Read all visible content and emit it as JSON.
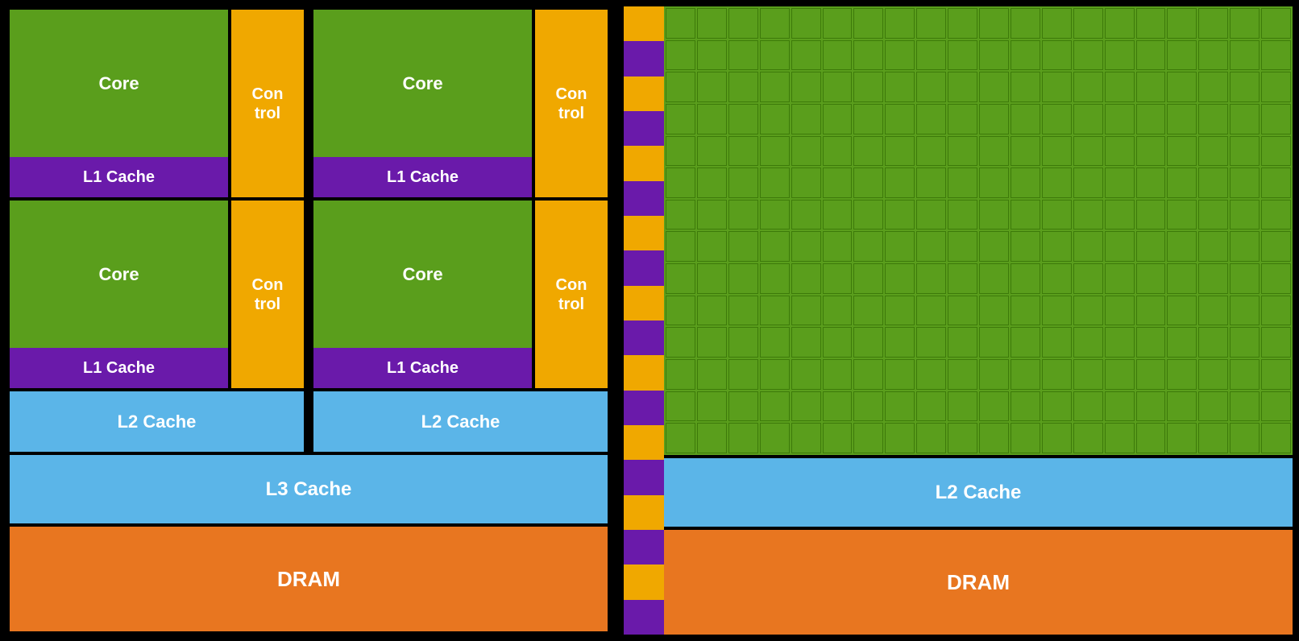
{
  "left": {
    "core_top_left": "Core",
    "core_top_right": "Core",
    "core_bottom_left": "Core",
    "core_bottom_right": "Core",
    "control_label": "Con\ntrol",
    "l1_cache_label": "L1 Cache",
    "l2_cache_left_label": "L2 Cache",
    "l2_cache_right_label": "L2 Cache",
    "l3_cache_label": "L3 Cache",
    "dram_label": "DRAM"
  },
  "right": {
    "l2_cache_label": "L2 Cache",
    "dram_label": "DRAM"
  },
  "colors": {
    "core_green": "#5a9e1c",
    "control_gold": "#f0a800",
    "cache_purple": "#6a1aaa",
    "cache_blue": "#5bb5e8",
    "dram_orange": "#e87620"
  }
}
